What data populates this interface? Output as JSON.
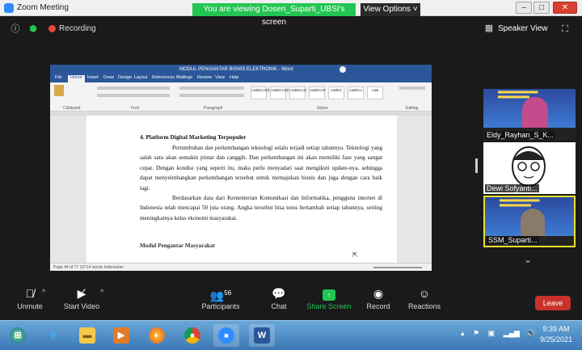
{
  "titlebar": {
    "title": "Zoom Meeting",
    "banner": "You are viewing Dosen_Suparti_UBSI's screen",
    "view_options": "View Options ˅"
  },
  "toolbar_top": {
    "recording": "Recording",
    "speaker_view": "Speaker View"
  },
  "word": {
    "title": "MODUL PENGANTAR BISNIS ELEKTRONIK - Word",
    "tabs": [
      "File",
      "Home",
      "Insert",
      "Draw",
      "Design",
      "Layout",
      "References",
      "Mailings",
      "Review",
      "View",
      "Help"
    ],
    "groups": [
      "Clipboard",
      "Font",
      "Paragraph",
      "Styles",
      "Editing"
    ],
    "styles": [
      "AaBbCcDd",
      "AaBbCcDd",
      "AaBbCcD",
      "AaBbCcD",
      "AaBbC",
      "AaBbCc",
      "AaB"
    ],
    "heading": "4.   Platform Digital Marketing Terpopuler",
    "paragraph1": "Pertumbuhan dan perkembangan teknologi selalu terjadi setiap tahunnya. Teknologi yang salah satu akan semakin pintar dan canggih. Dan perkembangan ini akan memiliki fase yang sangat cepat. Dengan kondisi yang seperti itu, maka perlu menyadari saat mengikuti update-nya, sehingga dapat menyeimbangkan perkembangan tersebut untuk memajukan bisnis dan juga dengan cara baik lagi.",
    "paragraph2": "Berdasarkan data dari Kementerian Komunikasi dan Informatika, pengguna internet di Indonesia telah mencapai 50 juta orang. Angka tersebut bisa terus bertambah setiap tahunnya, seiring meningkatnya kelas ekonomi masyarakat.",
    "subheading": "Modul Pengantar Masyarakat",
    "status": "Page 44 of 77     10714 words     Indonesian"
  },
  "participants": [
    {
      "name": "Eldy_Rayhan_S_K..."
    },
    {
      "name": "Dewi Sofyanti..."
    },
    {
      "name": "SSM_Suparti..."
    }
  ],
  "toolbar_bottom": {
    "unmute": "Unmute",
    "start_video": "Start Video",
    "participants": "Participants",
    "participants_count": "56",
    "chat": "Chat",
    "share_screen": "Share Screen",
    "record": "Record",
    "reactions": "Reactions",
    "leave": "Leave"
  },
  "taskbar": {
    "time": "9:39 AM",
    "date": "9/25/2021"
  },
  "colors": {
    "zoom_green": "#23c552",
    "leave_red": "#c9312b",
    "word_blue": "#2b579a"
  }
}
